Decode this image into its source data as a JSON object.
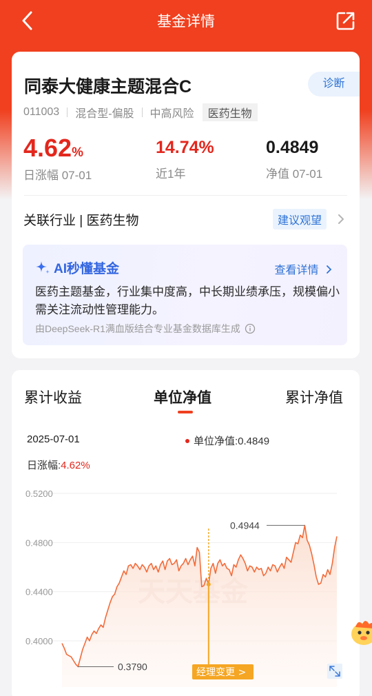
{
  "header": {
    "title": "基金详情",
    "back_icon": "chevron-left-icon",
    "share_icon": "share-icon"
  },
  "fund": {
    "name": "同泰大健康主题混合C",
    "diagnose_label": "诊断",
    "code": "011003",
    "type": "混合型-偏股",
    "risk": "中高风险",
    "sector_tag": "医药生物"
  },
  "stats": {
    "daily_change": "4.62",
    "daily_change_unit": "%",
    "daily_change_label": "日涨幅 07-01",
    "year_change": "14.74%",
    "year_change_label": "近1年",
    "nav": "0.4849",
    "nav_label": "净值 07-01"
  },
  "industry": {
    "label": "关联行业 | 医药生物",
    "advice": "建议观望"
  },
  "ai": {
    "title": "AI秒懂基金",
    "more": "查看详情",
    "text": "医药主题基金，行业集中度高，中长期业绩承压，规模偏小需关注流动性管理能力。",
    "source": "由DeepSeek-R1满血版结合专业基金数据库生成"
  },
  "tabs": [
    "累计收益",
    "单位净值",
    "累计净值"
  ],
  "chart_info": {
    "date": "2025-07-01",
    "legend": "单位净值:0.4849",
    "daily_label": "日涨幅:",
    "daily_value": "4.62%",
    "watermark": "天天基金",
    "manager_change": "经理变更 >",
    "max_label": "0.4944",
    "min_label": "0.3790"
  },
  "chart_data": {
    "type": "area",
    "title": "",
    "xlabel": "",
    "ylabel": "",
    "ylim": [
      0.37,
      0.52
    ],
    "yticks": [
      "0.5200",
      "0.4800",
      "0.4400",
      "0.4000"
    ],
    "series": [
      {
        "values": [
          0.398,
          0.394,
          0.389,
          0.388,
          0.387,
          0.384,
          0.381,
          0.379,
          0.386,
          0.393,
          0.398,
          0.403,
          0.4,
          0.405,
          0.408,
          0.406,
          0.41,
          0.413,
          0.411,
          0.419,
          0.425,
          0.431,
          0.436,
          0.438,
          0.444,
          0.447,
          0.452,
          0.457,
          0.454,
          0.461,
          0.462,
          0.459,
          0.463,
          0.461,
          0.458,
          0.462,
          0.46,
          0.456,
          0.461,
          0.463,
          0.458,
          0.461,
          0.456,
          0.462,
          0.465,
          0.458,
          0.465,
          0.467,
          0.462,
          0.463,
          0.466,
          0.457,
          0.461,
          0.463,
          0.467,
          0.462,
          0.466,
          0.469,
          0.461,
          0.476,
          0.472,
          0.444,
          0.445,
          0.451,
          0.446,
          0.459,
          0.463,
          0.455,
          0.463,
          0.466,
          0.461,
          0.463,
          0.459,
          0.458,
          0.453,
          0.462,
          0.46,
          0.466,
          0.47,
          0.467,
          0.463,
          0.457,
          0.461,
          0.46,
          0.456,
          0.46,
          0.458,
          0.459,
          0.453,
          0.455,
          0.46,
          0.457,
          0.462,
          0.461,
          0.456,
          0.46,
          0.463,
          0.459,
          0.468,
          0.466,
          0.464,
          0.472,
          0.48,
          0.479,
          0.486,
          0.484,
          0.494,
          0.482,
          0.478,
          0.471,
          0.462,
          0.452,
          0.446,
          0.447,
          0.454,
          0.452,
          0.458,
          0.454,
          0.463,
          0.476,
          0.485
        ]
      }
    ],
    "highlight_index": 64,
    "max_index": 106,
    "min_index": 7,
    "colors": {
      "line": "#f26b3a",
      "fill_top": "#fbdccd",
      "fill_bottom": "#fff6f2",
      "marker": "#f5a623",
      "manager_bg": "#f5a623"
    }
  }
}
